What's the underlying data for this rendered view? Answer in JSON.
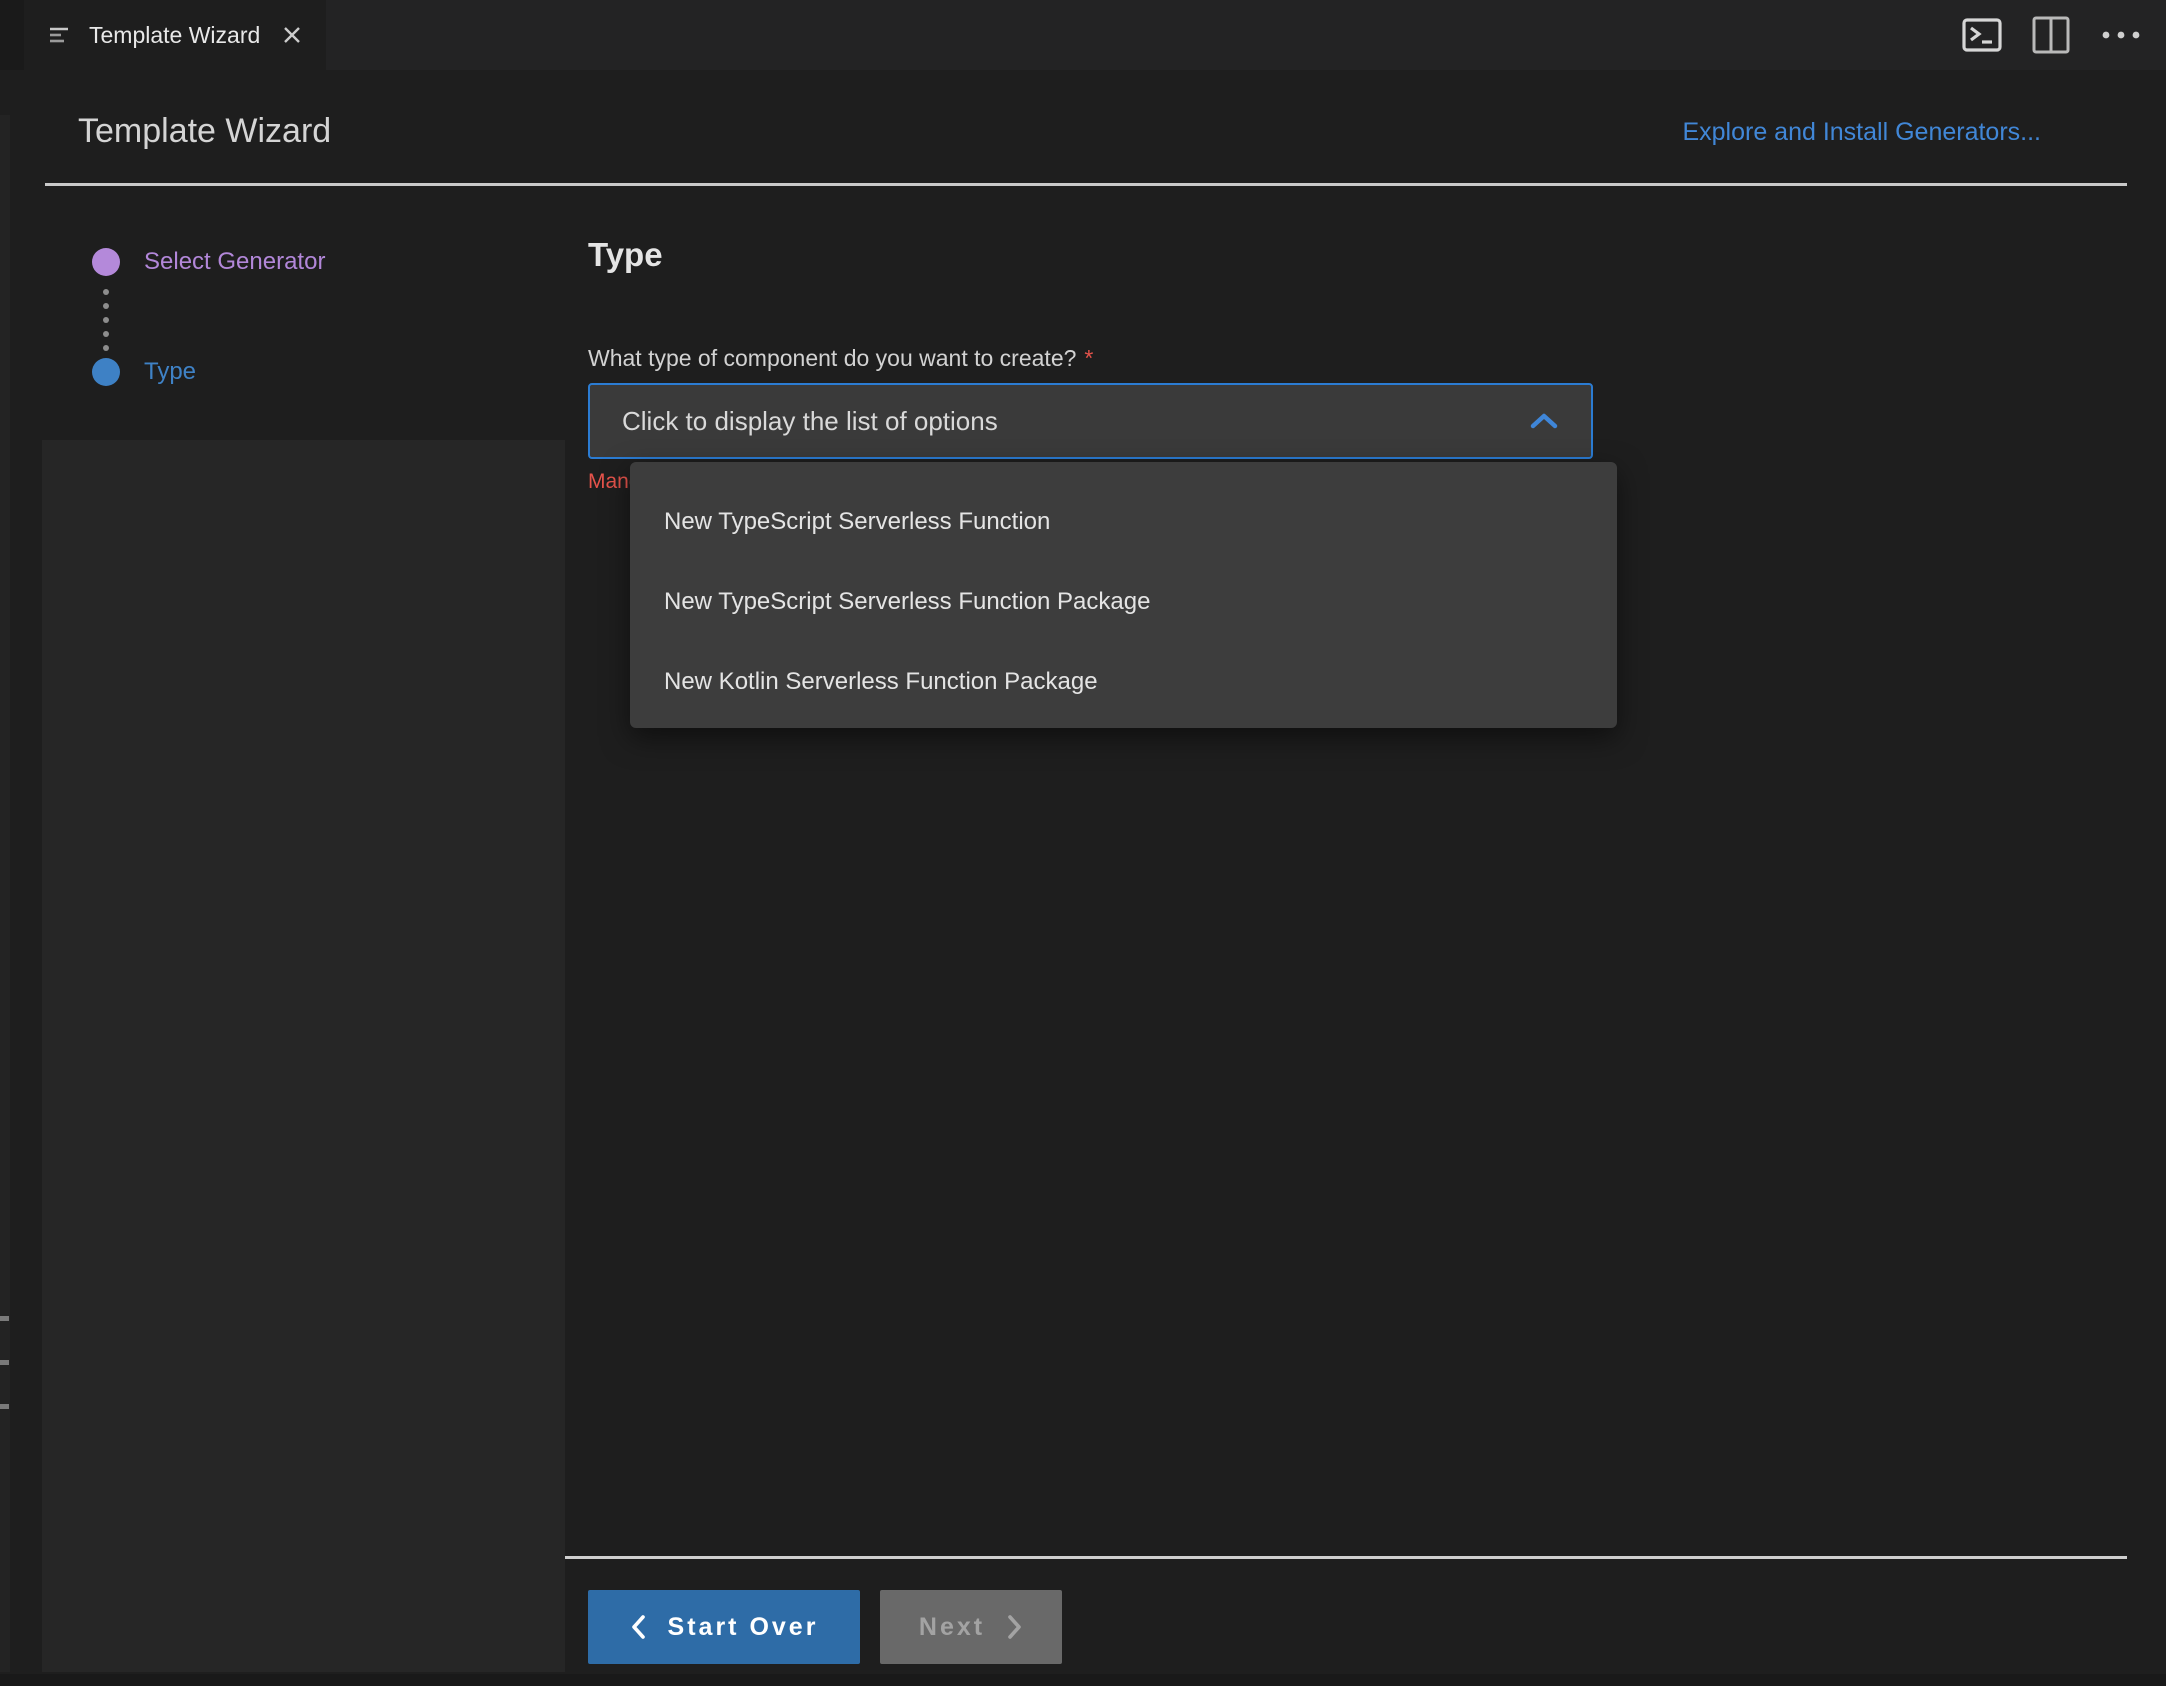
{
  "tab": {
    "title": "Template Wizard"
  },
  "tabbar": {
    "icons": [
      "panel-list-icon",
      "terminal-icon",
      "split-editor-icon",
      "more-actions-icon",
      "close-icon"
    ]
  },
  "header": {
    "title": "Template Wizard",
    "generators_link": "Explore and Install Generators..."
  },
  "stepper": {
    "steps": [
      {
        "label": "Select Generator",
        "state": "completed",
        "color": "#b489da"
      },
      {
        "label": "Type",
        "state": "current",
        "color": "#3e81c5"
      }
    ]
  },
  "content": {
    "heading": "Type",
    "question": "What type of component do you want to create?",
    "required_marker": "*",
    "dropdown": {
      "value": "Click to display the list of options",
      "chevron": "chevron-up-icon"
    },
    "validation_error": "Mandatory field",
    "options": [
      "New TypeScript Serverless Function",
      "New TypeScript Serverless Function Package",
      "New Kotlin Serverless Function Package"
    ]
  },
  "footer": {
    "start_over_label": "Start Over",
    "next_label": "Next"
  },
  "colors": {
    "accent_blue": "#2b7cd3",
    "link_blue": "#4187d7",
    "step_purple": "#b489da",
    "step_blue": "#3e81c5",
    "error_red": "#e5534b",
    "primary_button_blue": "#2e6ca7",
    "disabled_button_gray": "#696969"
  }
}
